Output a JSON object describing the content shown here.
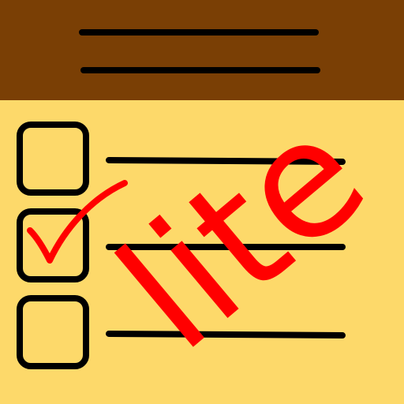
{
  "watermark": {
    "text": "lite",
    "color": "#ff0000"
  },
  "checklist": {
    "items": [
      {
        "checked": false
      },
      {
        "checked": true
      },
      {
        "checked": false
      }
    ]
  },
  "colors": {
    "header": "#7a3f05",
    "paper": "#fdd96a",
    "line": "#000000",
    "checkmark": "#ff0000"
  }
}
